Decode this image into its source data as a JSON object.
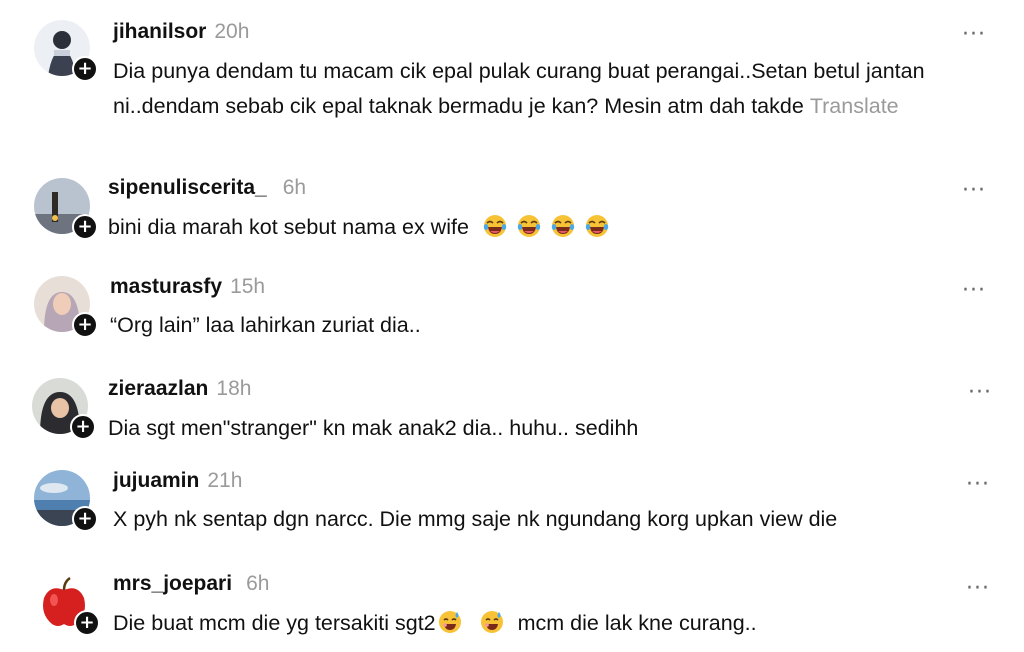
{
  "comments": [
    {
      "username": "jihanilsor",
      "time": "20h",
      "text": "Dia punya dendam tu macam cik epal pulak curang buat perangai..Setan betul jantan ni..dendam sebab cik epal taknak bermadu je kan? Mesin atm dah takde",
      "translate": "Translate",
      "more": "···",
      "follow": "+"
    },
    {
      "username": "sipenuliscerita_",
      "time": "6h",
      "text": "bini dia marah kot sebut nama ex wife",
      "emoji": "laughing-crying-emoji",
      "more": "···",
      "follow": "+"
    },
    {
      "username": "masturasfy",
      "time": "15h",
      "text": "“Org lain” laa lahirkan zuriat dia..",
      "more": "···",
      "follow": "+"
    },
    {
      "username": "zieraazlan",
      "time": "18h",
      "text": "Dia sgt men\"stranger\" kn mak anak2 dia.. huhu.. sedihh",
      "more": "···",
      "follow": "+"
    },
    {
      "username": "jujuamin",
      "time": "21h",
      "text": "X pyh nk sentap dgn narcc. Die mmg saje nk ngundang korg upkan view die",
      "more": "···",
      "follow": "+"
    },
    {
      "username": "mrs_joepari",
      "time": "6h",
      "text_before": "Die buat mcm die yg tersakiti sgt2",
      "text_after": "mcm die lak kne curang..",
      "emoji": "sweat-smile-emoji",
      "more": "···",
      "follow": "+"
    }
  ],
  "colors": {
    "text": "#111111",
    "muted": "#9a9a9a",
    "follow_badge": "#111111",
    "apple_red": "#d62020"
  }
}
